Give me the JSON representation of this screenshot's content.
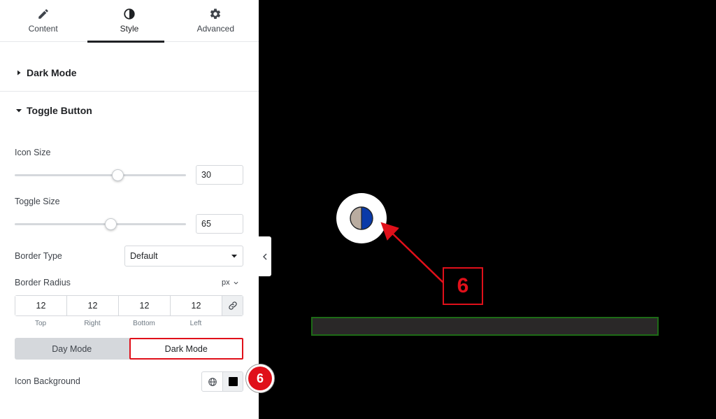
{
  "tabs": [
    {
      "label": "Content",
      "icon": "pencil-icon",
      "active": false
    },
    {
      "label": "Style",
      "icon": "half-circle-icon",
      "active": true
    },
    {
      "label": "Advanced",
      "icon": "gear-icon",
      "active": false
    }
  ],
  "sections": {
    "dark_mode": {
      "title": "Dark Mode",
      "expanded": false
    },
    "toggle_button": {
      "title": "Toggle Button",
      "expanded": true
    }
  },
  "controls": {
    "icon_size": {
      "label": "Icon Size",
      "value": "30",
      "slider_fraction": 0.6
    },
    "toggle_size": {
      "label": "Toggle Size",
      "value": "65",
      "slider_fraction": 0.56
    },
    "border_type": {
      "label": "Border Type",
      "value": "Default"
    },
    "border_radius": {
      "label": "Border Radius",
      "unit": "px",
      "values": [
        {
          "value": "12",
          "caption": "Top"
        },
        {
          "value": "12",
          "caption": "Right"
        },
        {
          "value": "12",
          "caption": "Bottom"
        },
        {
          "value": "12",
          "caption": "Left"
        }
      ]
    },
    "mode_switch": {
      "day_label": "Day Mode",
      "dark_label": "Dark Mode",
      "selected": "Dark Mode"
    },
    "icon_background": {
      "label": "Icon Background",
      "color": "#000000"
    }
  },
  "annotations": {
    "step_number": "6",
    "accent_color": "#e0101a"
  },
  "preview": {
    "toggle_icon": "half-circle-icon",
    "toggle_colors": {
      "light": "#b9aca0",
      "dark": "#0a3aa8"
    }
  }
}
